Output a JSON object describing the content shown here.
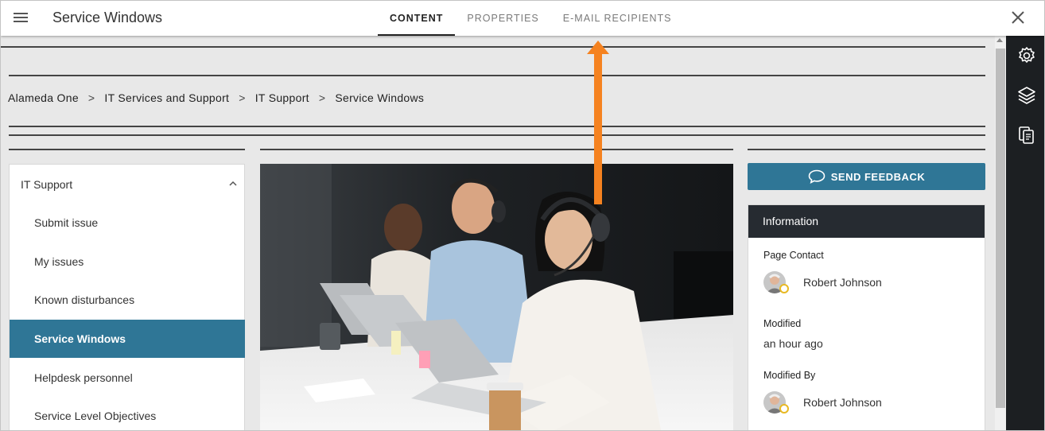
{
  "header": {
    "title": "Service Windows",
    "tabs": [
      {
        "label": "CONTENT",
        "active": true
      },
      {
        "label": "PROPERTIES",
        "active": false
      },
      {
        "label": "E-MAIL RECIPIENTS",
        "active": false
      }
    ],
    "icons": {
      "menu": "hamburger-menu-icon",
      "close": "close-icon"
    }
  },
  "breadcrumb": {
    "items": [
      "Alameda One",
      "IT Services and Support",
      "IT Support",
      "Service Windows"
    ],
    "separator": ">"
  },
  "nav": {
    "section_label": "IT Support",
    "items": [
      {
        "label": "Submit issue",
        "active": false
      },
      {
        "label": "My issues",
        "active": false
      },
      {
        "label": "Known disturbances",
        "active": false
      },
      {
        "label": "Service Windows",
        "active": true
      },
      {
        "label": "Helpdesk personnel",
        "active": false
      },
      {
        "label": "Service Level Objectives",
        "active": false
      }
    ]
  },
  "feedback": {
    "label": "SEND FEEDBACK",
    "icon": "chat-bubble-icon"
  },
  "info": {
    "title": "Information",
    "page_contact_label": "Page Contact",
    "page_contact_name": "Robert Johnson",
    "modified_label": "Modified",
    "modified_value": "an hour ago",
    "modified_by_label": "Modified By",
    "modified_by_name": "Robert Johnson"
  },
  "rail": {
    "icons": [
      "gear-icon",
      "layers-icon",
      "copy-pages-icon"
    ]
  },
  "colors": {
    "accent": "#2f7696",
    "info_header": "#262b31",
    "rail": "#1c1f22",
    "annotation_arrow": "#f58220",
    "presence": "#e8b923"
  }
}
